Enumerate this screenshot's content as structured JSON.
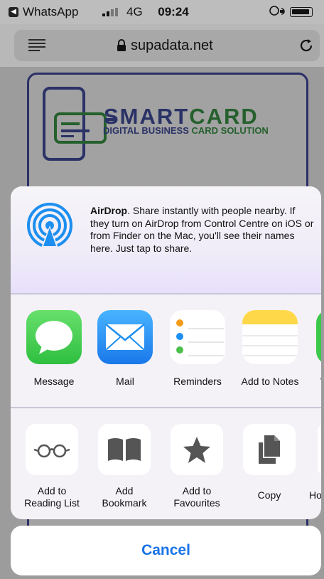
{
  "status_bar": {
    "app_name": "WhatsApp",
    "network": "4G",
    "time": "09:24",
    "back_badge": "◀"
  },
  "browser": {
    "domain": "supadata.net"
  },
  "page": {
    "logo_word_1": "SMART",
    "logo_word_2": "CARD",
    "logo_subtitle_1": "DIGITAL BUSINESS ",
    "logo_subtitle_2": "CARD SOLUTION"
  },
  "share_sheet": {
    "airdrop_title": "AirDrop",
    "airdrop_text": ". Share instantly with people nearby. If they turn on AirDrop from Control Centre on iOS or from Finder on the Mac, you'll see their names here. Just tap to share.",
    "apps": [
      {
        "label": "Message",
        "icon": "messages-icon"
      },
      {
        "label": "Mail",
        "icon": "mail-icon"
      },
      {
        "label": "Reminders",
        "icon": "reminders-icon"
      },
      {
        "label": "Add to Notes",
        "icon": "notes-icon"
      },
      {
        "label": "W",
        "icon": "whatsapp-icon"
      }
    ],
    "actions": [
      {
        "label_1": "Add to",
        "label_2": "Reading List",
        "icon": "glasses-icon"
      },
      {
        "label_1": "Add",
        "label_2": "Bookmark",
        "icon": "book-icon"
      },
      {
        "label_1": "Add to",
        "label_2": "Favourites",
        "icon": "star-icon"
      },
      {
        "label_1": "Copy",
        "label_2": "",
        "icon": "copy-icon"
      },
      {
        "label_1": "Ho",
        "label_2": "",
        "icon": "home-screen-icon"
      }
    ],
    "cancel_label": "Cancel"
  },
  "colors": {
    "accent": "#1a73e8",
    "messages_green": "#3cc94b",
    "mail_blue": "#1c8ff0",
    "notes_yellow": "#ffd84a",
    "logo_navy": "#2a3266",
    "logo_green": "#25602d"
  }
}
